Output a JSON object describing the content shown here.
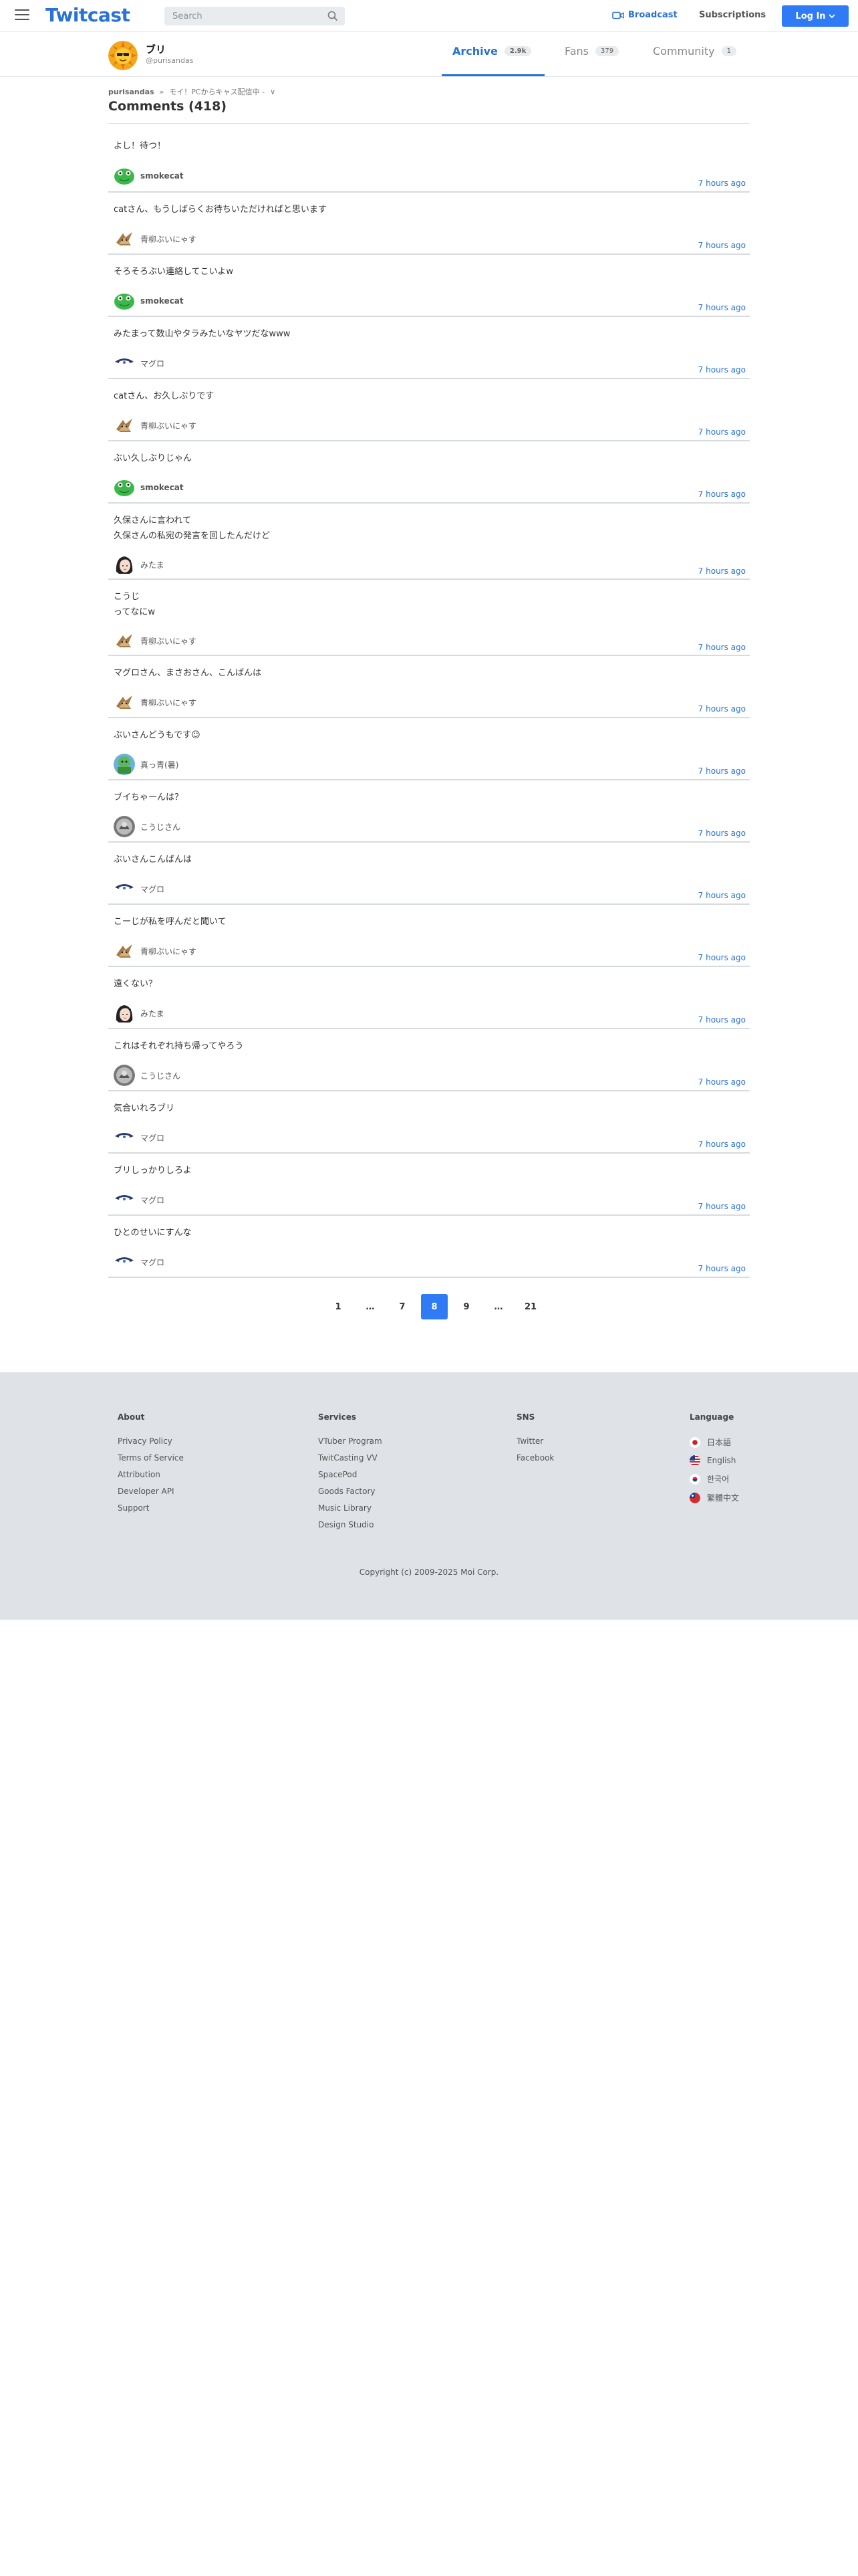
{
  "header": {
    "logo": "Twitcast",
    "search_placeholder": "Search",
    "broadcast_label": "Broadcast",
    "subscriptions_label": "Subscriptions",
    "login_label": "Log In"
  },
  "profile": {
    "name": "ブリ",
    "handle": "@purisandas",
    "tabs": [
      {
        "label": "Archive",
        "count": "2.9k"
      },
      {
        "label": "Fans",
        "count": "379"
      },
      {
        "label": "Community",
        "count": "1"
      }
    ]
  },
  "breadcrumb": {
    "user": "purisandas",
    "separator": "»",
    "movie": "モイ！PCからキャス配信中 -",
    "chevron": "∨"
  },
  "page_title": "Comments (418)",
  "comments": [
    {
      "text": "よし！待つ！",
      "author": "smokecat",
      "time": "7 hours ago"
    },
    {
      "text": "catさん、もうしばらくお待ちいただければと思います",
      "author": "青柳ぶいにゃす",
      "time": "7 hours ago"
    },
    {
      "text": "そろそろぶい連絡してこいよw",
      "author": "smokecat",
      "time": "7 hours ago"
    },
    {
      "text": "みたまって数山やタラみたいなヤツだなwww",
      "author": "マグロ",
      "time": "7 hours ago"
    },
    {
      "text": "catさん、お久しぶりです",
      "author": "青柳ぶいにゃす",
      "time": "7 hours ago"
    },
    {
      "text": "ぶい久しぶりじゃん",
      "author": "smokecat",
      "time": "7 hours ago"
    },
    {
      "text": "久保さんに言われて\n久保さんの私宛の発言を回したんだけど",
      "author": "みたま",
      "time": "7 hours ago"
    },
    {
      "text": "こうじ󠄀\n󠄀ってなにw",
      "author": "青柳ぶいにゃす",
      "time": "7 hours ago"
    },
    {
      "text": "マグロさん、まさおさん、こんばんは󠄀",
      "author": "青柳ぶいにゃす",
      "time": "7 hours ago"
    },
    {
      "text": "ぶいさんどうもです☺",
      "author": "真っ青(暑)",
      "time": "7 hours ago"
    },
    {
      "text": "ブイちゃーん󠄀は？",
      "author": "こうじさん",
      "time": "7 hours ago"
    },
    {
      "text": "ぶいさんこんばんは󠄀",
      "author": "マグロ",
      "time": "7 hours ago"
    },
    {
      "text": "こーじが私を呼んだと聞いて",
      "author": "青柳ぶいにゃす",
      "time": "7 hours ago"
    },
    {
      "text": "遠くない？",
      "author": "みたま",
      "time": "7 hours ago"
    },
    {
      "text": "これはそれぞれ持ち帰ってやろう",
      "author": "こうじさん",
      "time": "7 hours ago"
    },
    {
      "text": "気合いれろブリ",
      "author": "マグロ",
      "time": "7 hours ago"
    },
    {
      "text": "ブリしっかりしろよ",
      "author": "マグロ",
      "time": "7 hours ago"
    },
    {
      "text": "ひとのせいにすんな",
      "author": "マグロ",
      "time": "7 hours ago"
    }
  ],
  "pagination": [
    "1",
    "…",
    "7",
    "8",
    "9",
    "…",
    "21"
  ],
  "pagination_current": "8",
  "footer": {
    "about": {
      "title": "About",
      "links": [
        "Privacy Policy",
        "Terms of Service",
        "Attribution",
        "Developer API",
        "Support"
      ]
    },
    "services": {
      "title": "Services",
      "links": [
        "VTuber Program",
        "TwitCasting VV",
        "SpacePod",
        "Goods Factory",
        "Music Library",
        "Design Studio"
      ]
    },
    "sns": {
      "title": "SNS",
      "links": [
        "Twitter",
        "Facebook"
      ]
    },
    "language": {
      "title": "Language",
      "links": [
        "日本語",
        "English",
        "한국어",
        "繁體中文"
      ]
    },
    "copyright": "Copyright (c) 2009-2025 Moi Corp."
  },
  "colors": {
    "accent": "#2a72d4",
    "button": "#2f7bf5",
    "footer_bg": "#dfe2e6"
  }
}
